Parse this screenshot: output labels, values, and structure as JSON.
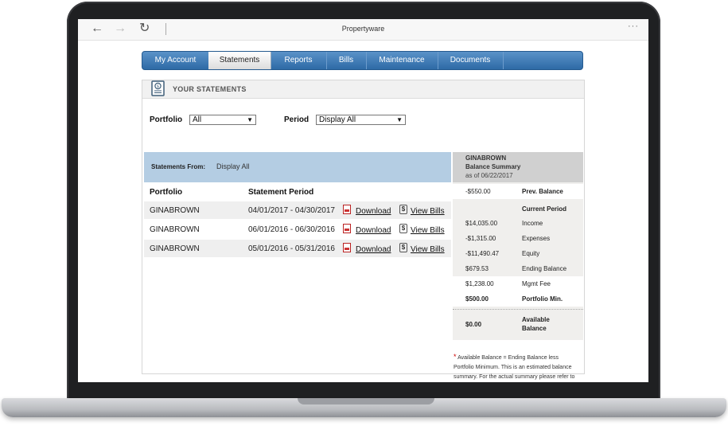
{
  "browser": {
    "title": "Propertyware",
    "back_glyph": "←",
    "forward_glyph": "→",
    "reload_glyph": "↻",
    "more_glyph": "···"
  },
  "nav": {
    "tabs": [
      {
        "label": "My Account",
        "active": false
      },
      {
        "label": "Statements",
        "active": true
      },
      {
        "label": "Reports",
        "active": false
      },
      {
        "label": "Bills",
        "active": false
      },
      {
        "label": "Maintenance",
        "active": false
      },
      {
        "label": "Documents",
        "active": false
      }
    ]
  },
  "panel": {
    "title": "YOUR STATEMENTS",
    "icon": "statement-icon"
  },
  "filters": {
    "portfolio_label": "Portfolio",
    "portfolio_value": "All",
    "period_label": "Period",
    "period_value": "Display All",
    "arrow_glyph": "▼"
  },
  "statements_from": {
    "label": "Statements From:",
    "value": "Display All"
  },
  "table": {
    "headers": [
      "Portfolio",
      "Statement Period"
    ],
    "download_label": "Download",
    "viewbills_label": "View Bills",
    "rows": [
      {
        "portfolio": "GINABROWN",
        "period": "04/01/2017 - 04/30/2017"
      },
      {
        "portfolio": "GINABROWN",
        "period": "06/01/2016 - 06/30/2016"
      },
      {
        "portfolio": "GINABROWN",
        "period": "05/01/2016 - 05/31/2016"
      }
    ]
  },
  "summary": {
    "name": "GINABROWN",
    "subtitle": "Balance Summary",
    "as_of": "as of 06/22/2017",
    "prev_balance_value": "-$550.00",
    "prev_balance_label": "Prev. Balance",
    "current_period_label": "Current Period",
    "income_value": "$14,035.00",
    "income_label": "Income",
    "expenses_value": "-$1,315.00",
    "expenses_label": "Expenses",
    "equity_value": "-$11,490.47",
    "equity_label": "Equity",
    "ending_value": "$679.53",
    "ending_label": "Ending Balance",
    "mgmt_value": "$1,238.00",
    "mgmt_label": "Mgmt Fee",
    "portfolio_min_value": "$500.00",
    "portfolio_min_label": "Portfolio Min.",
    "available_value": "$0.00",
    "available_label_1": "Available",
    "available_label_2": "Balance"
  },
  "footnote": {
    "star": "*",
    "text": "Available Balance = Ending Balance less Portfolio Minimum. This is an estimated balance summary. For the actual summary please refer to the published statements."
  }
}
